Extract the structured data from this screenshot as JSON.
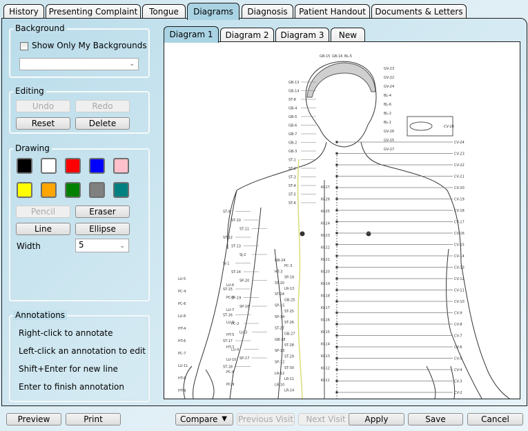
{
  "tabs": [
    {
      "label": "History",
      "active": false
    },
    {
      "label": "Presenting Complaint",
      "active": false
    },
    {
      "label": "Tongue",
      "active": false
    },
    {
      "label": "Diagrams",
      "active": true
    },
    {
      "label": "Diagnosis",
      "active": false
    },
    {
      "label": "Patient Handout",
      "active": false
    },
    {
      "label": "Documents & Letters",
      "active": false
    }
  ],
  "background": {
    "title": "Background",
    "show_only_mine_label": "Show Only My Backgrounds",
    "show_only_mine_checked": false,
    "selected_background": ""
  },
  "editing": {
    "title": "Editing",
    "undo_label": "Undo",
    "redo_label": "Redo",
    "reset_label": "Reset",
    "delete_label": "Delete"
  },
  "drawing": {
    "title": "Drawing",
    "colors": [
      {
        "name": "black",
        "hex": "#000000"
      },
      {
        "name": "white",
        "hex": "#ffffff"
      },
      {
        "name": "red",
        "hex": "#ff0000"
      },
      {
        "name": "blue",
        "hex": "#0000ff"
      },
      {
        "name": "pink",
        "hex": "#ffc0cb"
      },
      {
        "name": "yellow",
        "hex": "#ffff00"
      },
      {
        "name": "orange",
        "hex": "#ffa500"
      },
      {
        "name": "green",
        "hex": "#008000"
      },
      {
        "name": "gray",
        "hex": "#808080"
      },
      {
        "name": "teal",
        "hex": "#008080"
      }
    ],
    "pencil_label": "Pencil",
    "eraser_label": "Eraser",
    "line_label": "Line",
    "ellipse_label": "Ellipse",
    "width_label": "Width",
    "width_value": "5"
  },
  "annotations": {
    "title": "Annotations",
    "lines": [
      "Right-click to annotate",
      "Left-click an annotation to edit",
      "Shift+Enter for new line",
      "Enter to finish annotation"
    ]
  },
  "diagram_tabs": [
    {
      "label": "Diagram 1",
      "active": true
    },
    {
      "label": "Diagram 2",
      "active": false
    },
    {
      "label": "Diagram 3",
      "active": false
    },
    {
      "label": "New",
      "active": false
    }
  ],
  "diagram": {
    "description": "Acupuncture points body chart (front view, head, torso, arm)",
    "head_labels_left": [
      "GB-13",
      "GB-14",
      "ST-8",
      "GB-4",
      "GB-5",
      "GB-6",
      "GB-7",
      "GB-2",
      "GB-3",
      "ST-1",
      "ST-2",
      "ST-3",
      "ST-4",
      "ST-5",
      "ST-6"
    ],
    "head_labels_top": [
      "GB-15",
      "GB-16",
      "BL-5"
    ],
    "head_labels_right": [
      "GV-23",
      "GV-22",
      "GV-24",
      "BL-4",
      "BL-6",
      "BL-2",
      "BL-1",
      "GV-26",
      "GV-25",
      "GV-27"
    ],
    "inset_label": "CV-28",
    "cv_labels": [
      "CV-24",
      "CV-23",
      "CV-22",
      "CV-21",
      "CV-20",
      "CV-19",
      "CV-18",
      "CV-17",
      "CV-16",
      "CV-15",
      "CV-14",
      "CV-13",
      "CV-12",
      "CV-11",
      "CV-10",
      "CV-9",
      "CV-8",
      "CV-7",
      "CV-6",
      "CV-5",
      "CV-4",
      "CV-3",
      "CV-2"
    ],
    "ki_labels": [
      "KI-27",
      "KI-26",
      "KI-25",
      "KI-24",
      "KI-23",
      "KI-22",
      "KI-21",
      "KI-20",
      "KI-19",
      "KI-18",
      "KI-17",
      "KI-16",
      "KI-15",
      "KI-14",
      "KI-13",
      "KI-12",
      "KI-11"
    ],
    "torso_labels_left": [
      "ST-9",
      "ST-10",
      "ST-11",
      "ST-12",
      "ST-13",
      "SJ-2",
      "SJ-1",
      "ST-14",
      "SP-20",
      "ST-15",
      "SP-19",
      "SP-18",
      "ST-16",
      "PC-2",
      "LU-3",
      "ST-17",
      "LU-4",
      "SP-17",
      "ST-18"
    ],
    "arm_labels": [
      "LU-5",
      "LU-6",
      "PC-4",
      "PC-5",
      "PC-6",
      "LU-7",
      "LU-8",
      "LU-9",
      "HT-4",
      "HT-5",
      "HT-6",
      "HT-7",
      "PC-7",
      "LU-10",
      "LU-11",
      "PC-8",
      "HT-8",
      "PC-9",
      "HT-9"
    ],
    "abdomen_labels": [
      "GB-24",
      "PC-3",
      "HT-3",
      "SP-16",
      "ST-20",
      "LR-13",
      "ST-24",
      "GB-25",
      "SP-15",
      "ST-25",
      "SP-14",
      "ST-26",
      "ST-27",
      "GB-27",
      "GB-28",
      "ST-28",
      "SP-13",
      "ST-29",
      "SP-12",
      "ST-30",
      "LR-12",
      "LR-11",
      "LR-10",
      "LR-14"
    ]
  },
  "footer": {
    "preview_label": "Preview",
    "print_label": "Print",
    "compare_label": "Compare",
    "previous_visit_label": "Previous Visit",
    "next_visit_label": "Next Visit",
    "apply_label": "Apply",
    "save_label": "Save",
    "cancel_label": "Cancel"
  }
}
